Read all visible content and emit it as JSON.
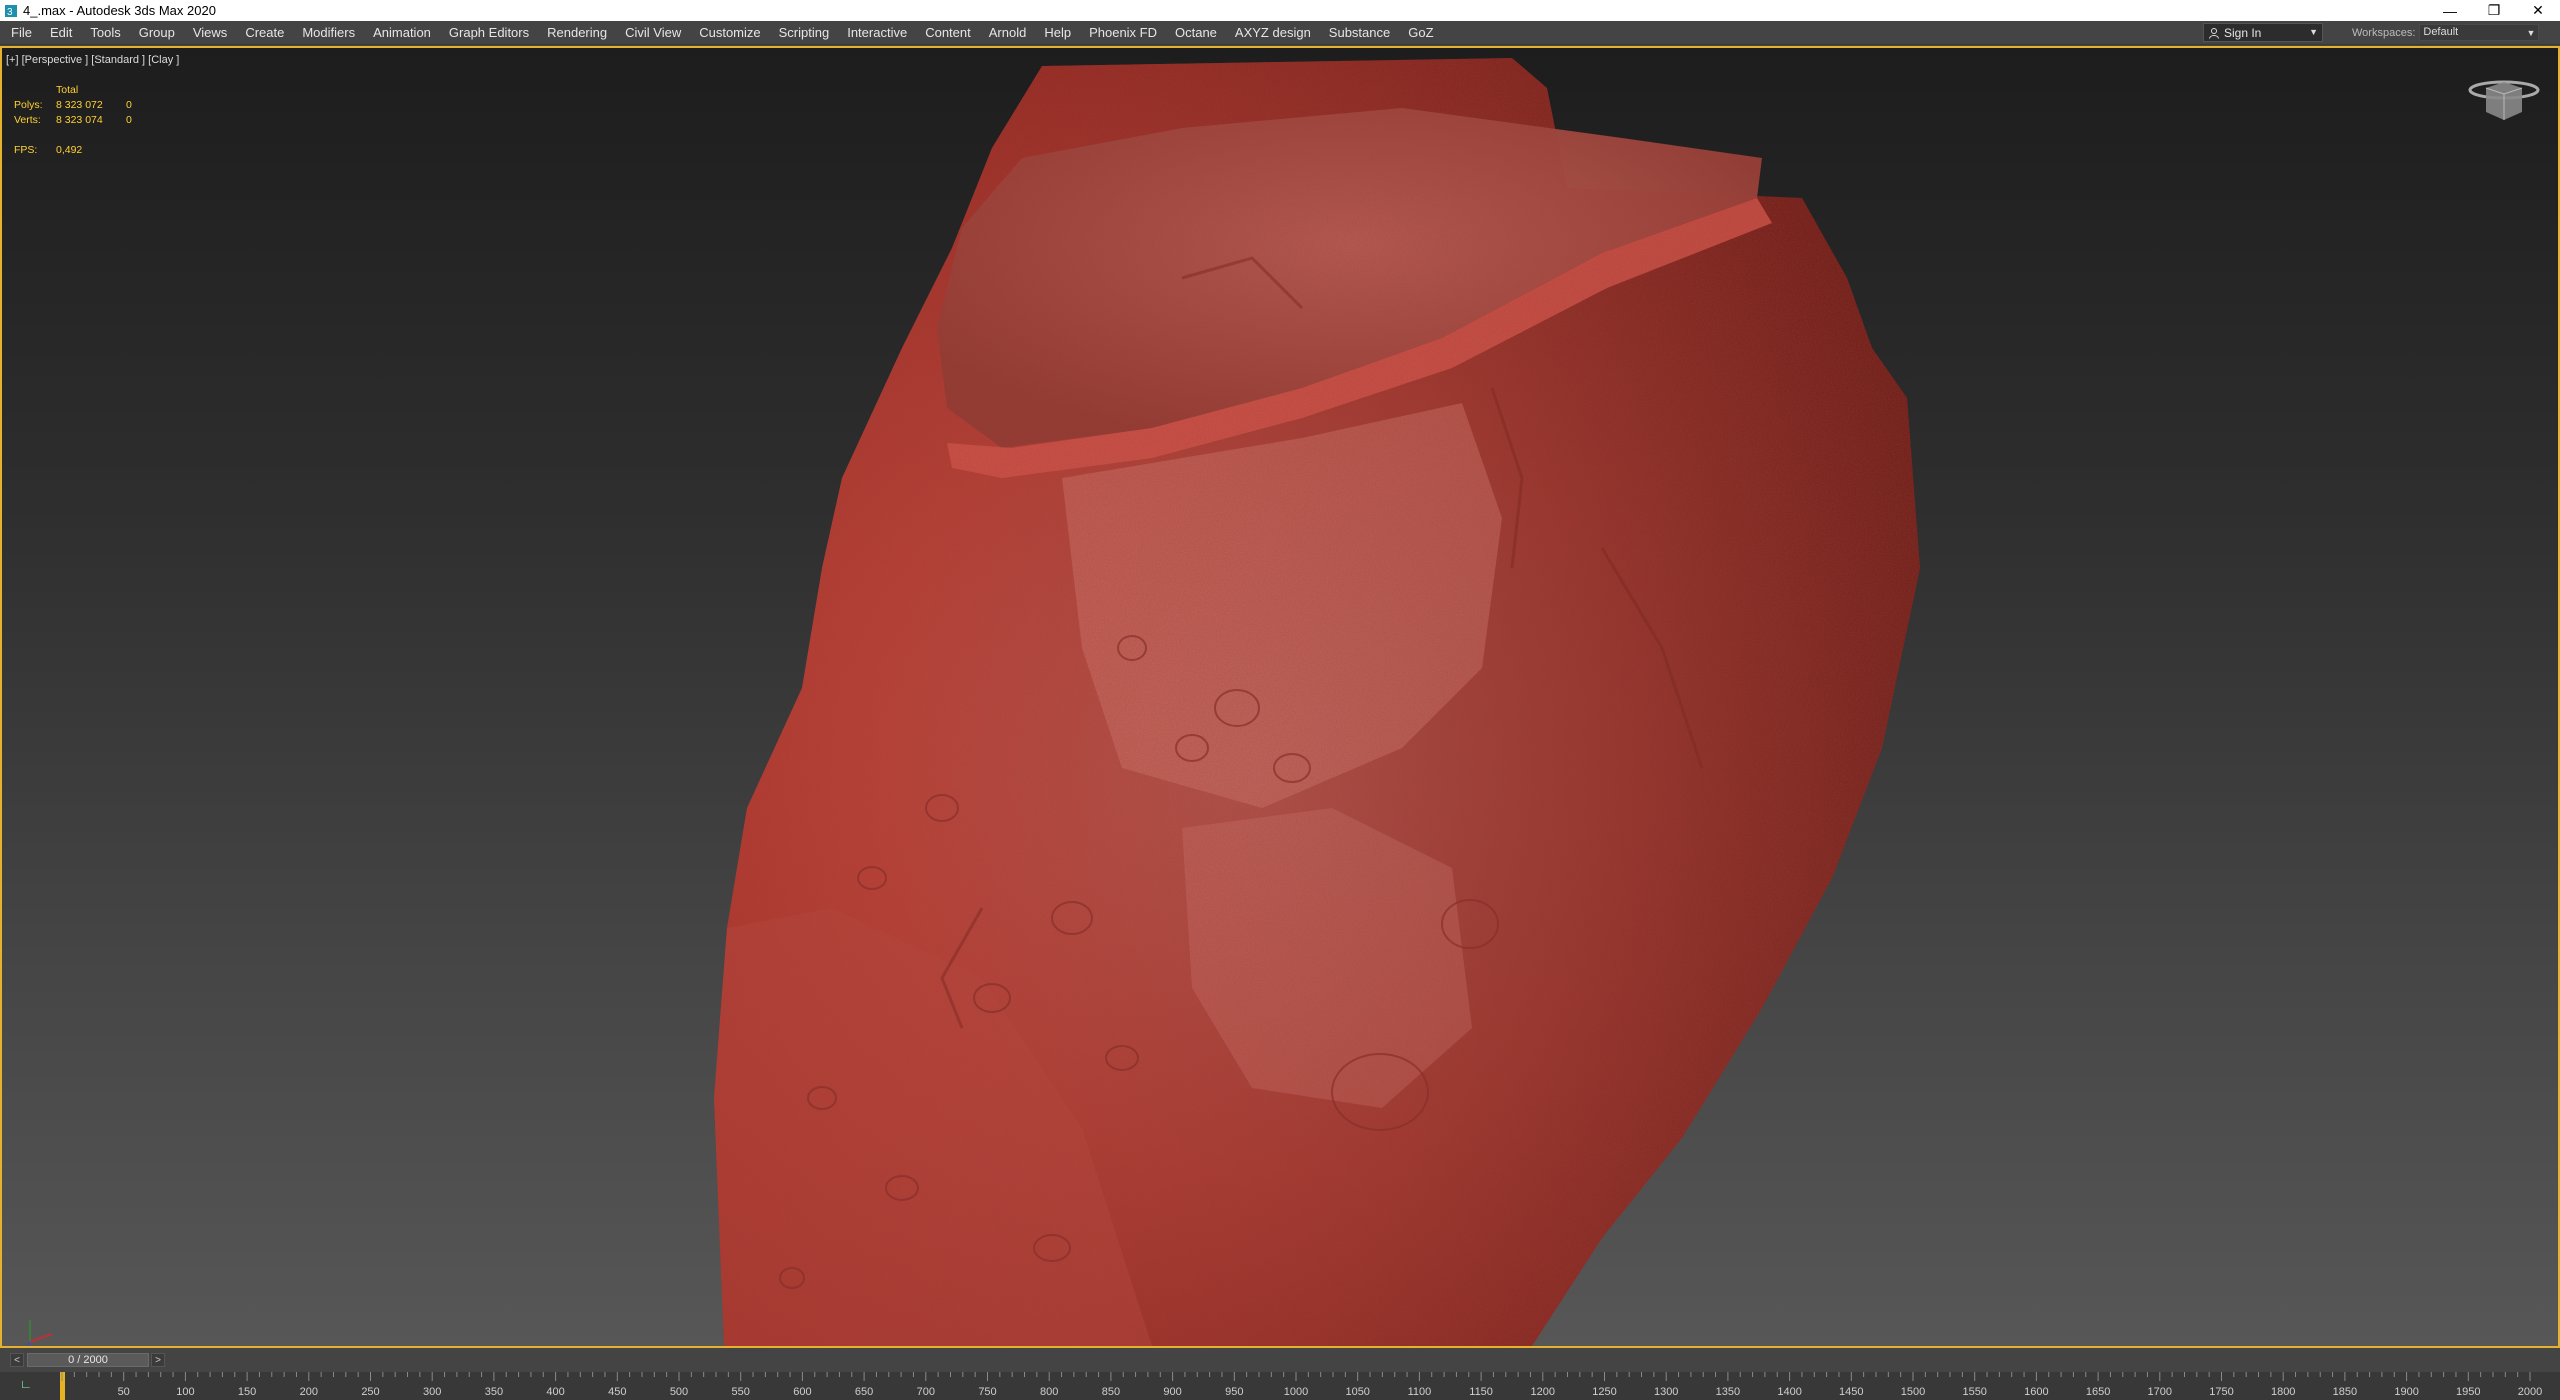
{
  "window": {
    "title": "4_.max - Autodesk 3ds Max 2020",
    "controls": {
      "minimize": "—",
      "restore": "❐",
      "close": "✕"
    }
  },
  "menu": {
    "items": [
      "File",
      "Edit",
      "Tools",
      "Group",
      "Views",
      "Create",
      "Modifiers",
      "Animation",
      "Graph Editors",
      "Rendering",
      "Civil View",
      "Customize",
      "Scripting",
      "Interactive",
      "Content",
      "Arnold",
      "Help",
      "Phoenix FD",
      "Octane",
      "AXYZ design",
      "Substance",
      "GoZ"
    ],
    "sign_in": "Sign In",
    "workspaces_label": "Workspaces:",
    "workspace_value": "Default"
  },
  "viewport": {
    "label": "[+] [Perspective ] [Standard ] [Clay ]",
    "stats": {
      "header": "Total",
      "polys_label": "Polys:",
      "polys_total": "8 323 072",
      "polys_sel": "0",
      "verts_label": "Verts:",
      "verts_total": "8 323 074",
      "verts_sel": "0",
      "fps_label": "FPS:",
      "fps_value": "0,492"
    },
    "colors": {
      "border": "#e4b22f",
      "stats_text": "#ffd232",
      "rock": "#c9372e"
    }
  },
  "timeline": {
    "slider_text": "0 / 2000",
    "prev": "<",
    "next": ">",
    "ticks": [
      "50",
      "100",
      "150",
      "200",
      "250",
      "300",
      "350",
      "400",
      "450",
      "500",
      "550",
      "600",
      "650",
      "700",
      "750",
      "800",
      "850",
      "900",
      "950",
      "1000",
      "1050",
      "1100",
      "1150",
      "1200",
      "1250",
      "1300",
      "1350",
      "1400",
      "1450",
      "1500",
      "1550",
      "1600",
      "1650",
      "1700",
      "1750",
      "1800",
      "1850",
      "1900",
      "1950",
      "2000"
    ]
  }
}
